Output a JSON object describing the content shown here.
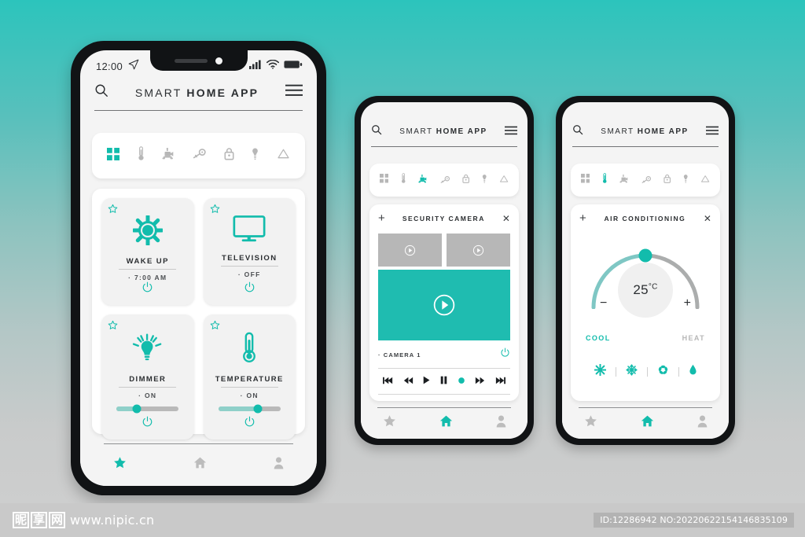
{
  "app": {
    "title_light": "SMART ",
    "title_bold": "HOME APP",
    "search_icon": "search-icon",
    "menu_icon": "hamburger-menu-icon"
  },
  "status_bar": {
    "time": "12:00",
    "location_icon": "location-arrow-icon",
    "signal_icon": "cellular-signal-icon",
    "wifi_icon": "wifi-icon",
    "battery_icon": "battery-full-icon"
  },
  "tabs": [
    {
      "name": "dashboard",
      "icon": "grid-icon"
    },
    {
      "name": "temperature",
      "icon": "thermometer-icon"
    },
    {
      "name": "camera",
      "icon": "security-camera-icon"
    },
    {
      "name": "key",
      "icon": "key-icon"
    },
    {
      "name": "lock",
      "icon": "padlock-icon"
    },
    {
      "name": "lighting",
      "icon": "bulb-icon"
    },
    {
      "name": "recycle",
      "icon": "recycle-triangle-icon"
    }
  ],
  "phone1": {
    "active_tab_index": 0,
    "devices": [
      {
        "name": "WAKE UP",
        "state": "7:00 AM",
        "icon": "sun-icon",
        "has_slider": false,
        "slider_pct": 0
      },
      {
        "name": "TELEVISION",
        "state": "OFF",
        "icon": "television-icon",
        "has_slider": false,
        "slider_pct": 0
      },
      {
        "name": "DIMMER",
        "state": "ON",
        "icon": "light-bulb-rays-icon",
        "has_slider": true,
        "slider_pct": 32
      },
      {
        "name": "TEMPERATURE",
        "state": "ON",
        "icon": "thermometer-icon",
        "has_slider": true,
        "slider_pct": 64
      }
    ],
    "nav": {
      "active": "favorites",
      "items": [
        {
          "name": "favorites",
          "icon": "star-icon"
        },
        {
          "name": "home",
          "icon": "home-icon"
        },
        {
          "name": "profile",
          "icon": "user-icon"
        }
      ]
    }
  },
  "phone2": {
    "active_tab_index": 2,
    "panel": {
      "title": "SECURITY CAMERA",
      "add_label": "+",
      "close_label": "✕",
      "thumbnails": [
        {
          "name": "camera-thumb-1",
          "icon": "play-circle-icon"
        },
        {
          "name": "camera-thumb-2",
          "icon": "play-circle-icon"
        }
      ],
      "main_feed": {
        "name": "camera-main-feed",
        "icon": "play-circle-icon"
      },
      "camera_label": "CAMERA 1",
      "power_icon": "power-icon",
      "controls": [
        {
          "name": "skip-back-button",
          "icon": "skip-back-icon"
        },
        {
          "name": "rewind-button",
          "icon": "rewind-icon"
        },
        {
          "name": "play-button",
          "icon": "play-icon"
        },
        {
          "name": "pause-button",
          "icon": "pause-icon"
        },
        {
          "name": "record-button",
          "icon": "record-dot-icon"
        },
        {
          "name": "fast-forward-button",
          "icon": "fast-forward-icon"
        },
        {
          "name": "skip-forward-button",
          "icon": "skip-forward-icon"
        }
      ]
    },
    "nav": {
      "active": "home",
      "items": [
        {
          "name": "favorites",
          "icon": "star-icon"
        },
        {
          "name": "home",
          "icon": "home-icon"
        },
        {
          "name": "profile",
          "icon": "user-icon"
        }
      ]
    }
  },
  "phone3": {
    "active_tab_index": 1,
    "panel": {
      "title": "AIR CONDITIONING",
      "add_label": "+",
      "close_label": "✕",
      "temperature_value": "25",
      "temperature_unit": "°C",
      "dial_pct": 50,
      "minus_label": "−",
      "plus_label": "+",
      "mode_cool": "COOL",
      "mode_heat": "HEAT",
      "modes": [
        {
          "name": "dry-mode-button",
          "icon": "sun-burst-icon"
        },
        {
          "name": "cool-mode-button",
          "icon": "snowflake-icon"
        },
        {
          "name": "fan-mode-button",
          "icon": "fan-icon"
        },
        {
          "name": "humidity-mode-button",
          "icon": "water-drop-icon"
        }
      ]
    },
    "nav": {
      "active": "home",
      "items": [
        {
          "name": "favorites",
          "icon": "star-icon"
        },
        {
          "name": "home",
          "icon": "home-icon"
        },
        {
          "name": "profile",
          "icon": "user-icon"
        }
      ]
    }
  },
  "footer": {
    "logo_chars": [
      "昵",
      "享",
      "网"
    ],
    "url": "www.nipic.cn",
    "id_text": "ID:12286942 NO:20220622154146835109"
  },
  "colors": {
    "accent": "#12bcac",
    "accent_light": "#8fd0c9",
    "video_teal": "#1fbcb0",
    "gray_icon": "#b7b7b7",
    "text_dark": "#2b2e31",
    "bg_top": "#2cc4bc",
    "bg_bottom": "#cfcfcf"
  }
}
